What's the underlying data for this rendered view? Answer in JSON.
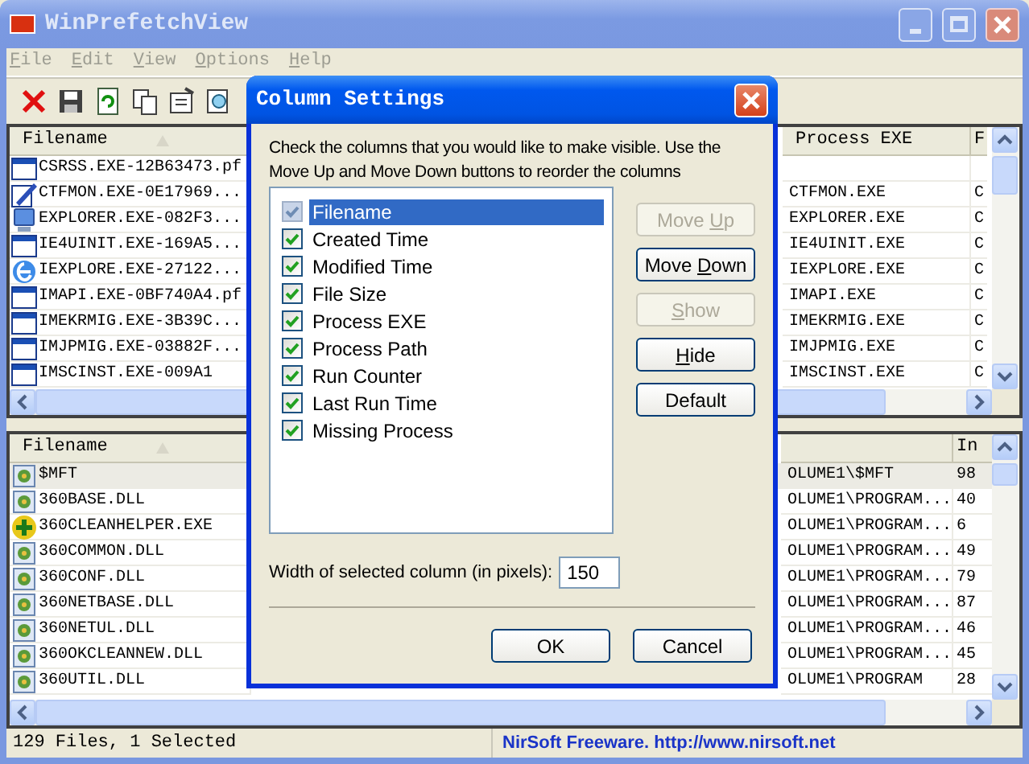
{
  "window": {
    "title": "WinPrefetchView"
  },
  "menu": [
    {
      "key": "F",
      "rest": "ile",
      "disabled": true
    },
    {
      "key": "E",
      "rest": "dit",
      "disabled": true
    },
    {
      "key": "V",
      "rest": "iew",
      "disabled": true
    },
    {
      "key": "O",
      "rest": "ptions",
      "disabled": true
    },
    {
      "key": "H",
      "rest": "elp",
      "disabled": true
    }
  ],
  "upper_list": {
    "columns": [
      "Filename",
      "Process EXE",
      "F"
    ],
    "rows": [
      {
        "kind": "window",
        "cells": [
          "CSRSS.EXE-12B63473.pf",
          "",
          ""
        ]
      },
      {
        "kind": "pen",
        "cells": [
          "CTFMON.EXE-0E17969...",
          "CTFMON.EXE",
          "C"
        ]
      },
      {
        "kind": "computer",
        "cells": [
          "EXPLORER.EXE-082F3...",
          "EXPLORER.EXE",
          "C"
        ]
      },
      {
        "kind": "window",
        "cells": [
          "IE4UINIT.EXE-169A5...",
          "IE4UINIT.EXE",
          "C"
        ]
      },
      {
        "kind": "globe",
        "cells": [
          "IEXPLORE.EXE-27122...",
          "IEXPLORE.EXE",
          "C"
        ]
      },
      {
        "kind": "window",
        "cells": [
          "IMAPI.EXE-0BF740A4.pf",
          "IMAPI.EXE",
          "C"
        ]
      },
      {
        "kind": "window",
        "cells": [
          "IMEKRMIG.EXE-3B39C...",
          "IMEKRMIG.EXE",
          "C"
        ]
      },
      {
        "kind": "window",
        "cells": [
          "IMJPMIG.EXE-03882F...",
          "IMJPMIG.EXE",
          "C"
        ]
      },
      {
        "kind": "window",
        "cells": [
          "IMSCINST.EXE-009A1",
          "IMSCINST.EXE",
          "C"
        ]
      }
    ]
  },
  "lower_list": {
    "columns": [
      "Filename",
      null,
      "In"
    ],
    "rows": [
      {
        "kind": "dll",
        "selected": true,
        "cells": [
          "$MFT",
          "OLUME1\\$MFT",
          "98"
        ]
      },
      {
        "kind": "dll",
        "selected": false,
        "cells": [
          "360BASE.DLL",
          "OLUME1\\PROGRAM...",
          "40"
        ]
      },
      {
        "kind": "plus",
        "selected": false,
        "cells": [
          "360CLEANHELPER.EXE",
          "OLUME1\\PROGRAM...",
          "6"
        ]
      },
      {
        "kind": "dll",
        "selected": false,
        "cells": [
          "360COMMON.DLL",
          "OLUME1\\PROGRAM...",
          "49"
        ]
      },
      {
        "kind": "dll",
        "selected": false,
        "cells": [
          "360CONF.DLL",
          "OLUME1\\PROGRAM...",
          "79"
        ]
      },
      {
        "kind": "dll",
        "selected": false,
        "cells": [
          "360NETBASE.DLL",
          "OLUME1\\PROGRAM...",
          "87"
        ]
      },
      {
        "kind": "dll",
        "selected": false,
        "cells": [
          "360NETUL.DLL",
          "OLUME1\\PROGRAM...",
          "46"
        ]
      },
      {
        "kind": "dll",
        "selected": false,
        "cells": [
          "360OKCLEANNEW.DLL",
          "OLUME1\\PROGRAM...",
          "45"
        ]
      },
      {
        "kind": "dll",
        "selected": false,
        "cells": [
          "360UTIL.DLL",
          "OLUME1\\PROGRAM",
          "28"
        ]
      }
    ]
  },
  "dialog": {
    "title": "Column Settings",
    "description": "Check the columns that you would like to make visible. Use the Move Up and Move Down buttons to reorder the columns",
    "columns": [
      {
        "label": "Filename",
        "checked": true,
        "disabled": true,
        "selected": true
      },
      {
        "label": "Created Time",
        "checked": true,
        "disabled": false,
        "selected": false
      },
      {
        "label": "Modified Time",
        "checked": true,
        "disabled": false,
        "selected": false
      },
      {
        "label": "File Size",
        "checked": true,
        "disabled": false,
        "selected": false
      },
      {
        "label": "Process EXE",
        "checked": true,
        "disabled": false,
        "selected": false
      },
      {
        "label": "Process Path",
        "checked": true,
        "disabled": false,
        "selected": false
      },
      {
        "label": "Run Counter",
        "checked": true,
        "disabled": false,
        "selected": false
      },
      {
        "label": "Last Run Time",
        "checked": true,
        "disabled": false,
        "selected": false
      },
      {
        "label": "Missing Process",
        "checked": true,
        "disabled": false,
        "selected": false
      }
    ],
    "buttons": [
      {
        "pre": "Move ",
        "key": "U",
        "post": "p",
        "disabled": true
      },
      {
        "pre": "Move ",
        "key": "D",
        "post": "own",
        "disabled": false
      },
      {
        "key": "S",
        "post": "how",
        "disabled": true
      },
      {
        "key": "H",
        "post": "ide",
        "disabled": false
      },
      {
        "pre": "Default",
        "disabled": false
      }
    ],
    "width_label": "Width of selected column (in pixels):",
    "width_value": "150",
    "ok": "OK",
    "cancel": "Cancel"
  },
  "status_bar": {
    "count": "129 Files, 1 Selected",
    "credit": "NirSoft Freeware.  http://www.nirsoft.net"
  }
}
